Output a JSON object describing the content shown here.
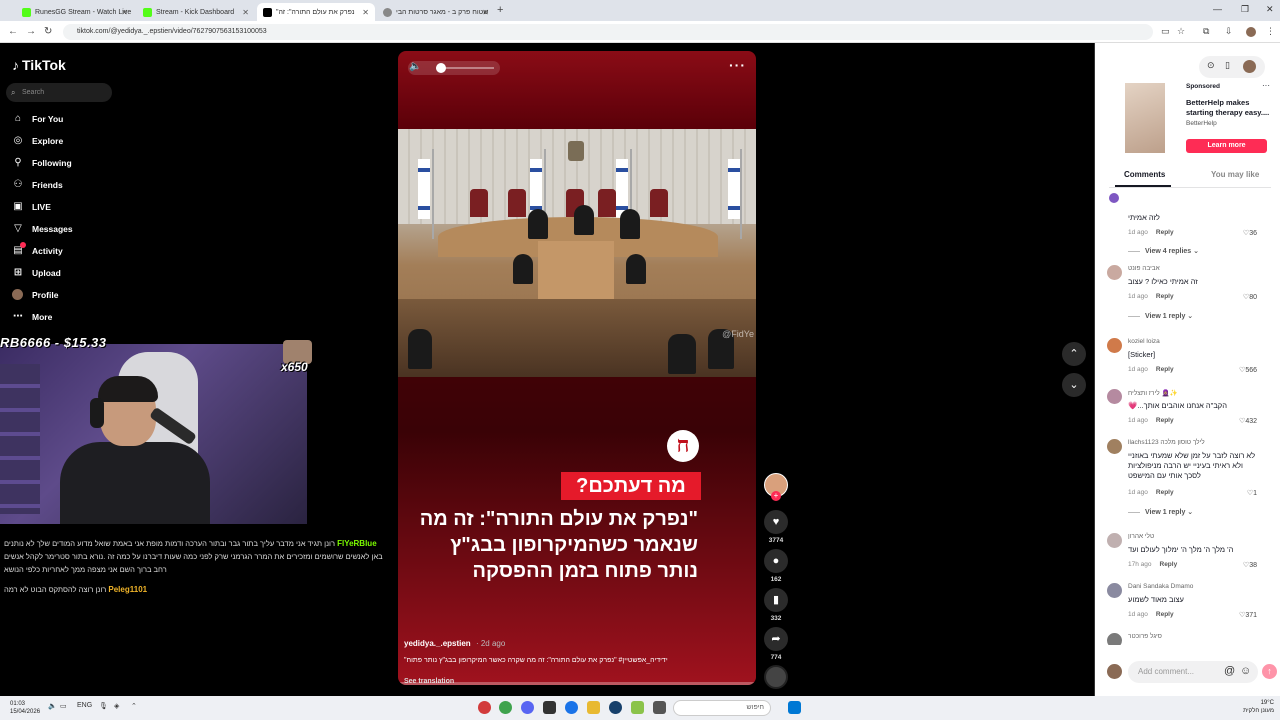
{
  "browser": {
    "tabs": [
      {
        "title": "RunesGG Stream - Watch Live",
        "color": "#53fc18"
      },
      {
        "title": "Stream - Kick Dashboard",
        "color": "#53fc18"
      },
      {
        "title": "\"נפרק את עולם התורה\": זה",
        "color": "#000000"
      },
      {
        "title": "שטוח פרק ב - מאגר סרטות הבי",
        "color": "#888888"
      }
    ],
    "url": "tiktok.com/@yedidya._.epstien/video/7627907563153100053"
  },
  "tiktok": {
    "logo": "TikTok",
    "search_placeholder": "Search",
    "nav": [
      {
        "label": "For You",
        "icon": "home-icon"
      },
      {
        "label": "Explore",
        "icon": "compass-icon"
      },
      {
        "label": "Following",
        "icon": "following-icon"
      },
      {
        "label": "Friends",
        "icon": "friends-icon"
      },
      {
        "label": "LIVE",
        "icon": "live-icon"
      },
      {
        "label": "Messages",
        "icon": "messages-icon"
      },
      {
        "label": "Activity",
        "icon": "activity-icon"
      },
      {
        "label": "Upload",
        "icon": "upload-icon"
      },
      {
        "label": "Profile",
        "icon": "avatar"
      },
      {
        "label": "More",
        "icon": "more-icon"
      }
    ]
  },
  "stream_overlay": {
    "donation": "RB6666 - $15.33",
    "multiplier": "x650",
    "chat": [
      {
        "user": "FlYeRBlue",
        "color": "#7cfc00",
        "text": "רונן תגיד אני מדבר עליך בתור גבר ובתור הערכה ודמות מופת אני באמת שואל מדוע המודים שלך לא נותנים באן לאנשים שרושמים ומזכירים את המרר הגרמני שרק לפני כמה שעות דיברנו על כמה זה .נורא בתור סטרימר לקהל אנשים רחב ברוך השם אני מצפה ממך לאחריות כלפי הנושא"
      },
      {
        "user": "Peleg1101",
        "color": "#f0b429",
        "text": "רונן רוצה להסתקס הבוט לא רמה"
      }
    ]
  },
  "video": {
    "badge_label": "מה דעתכם?",
    "headline": "\"נפרק את עולם התורה\": זה מה שנאמר כשהמיקרופון בבג\"ץ נותר פתוח בזמן ההפסקה",
    "channel_logo": "ח",
    "watermark": "@FidYe",
    "author": "yedidya._.epstien",
    "posted": "2d ago",
    "caption": "ידידיה_אפשטיין# \"נפרק את עולם התורה\": זה מה שקרה כאשר המיקרופון בבג\"ץ נותר פתוח\"",
    "see_translation": "See translation",
    "volume_level": 0.05
  },
  "actions": {
    "likes": "3774",
    "comments": "162",
    "saves": "332",
    "shares": "774"
  },
  "ad": {
    "sponsored": "Sponsored",
    "title": "BetterHelp makes starting therapy easy....",
    "brand": "BetterHelp",
    "cta": "Learn more"
  },
  "panel_tabs": {
    "comments": "Comments",
    "you_may_like": "You may like"
  },
  "comments": [
    {
      "name": "",
      "text": "לזה אמיתי",
      "time": "1d ago",
      "likes": "36",
      "replies": "View 4 replies",
      "color": "#7e57c2"
    },
    {
      "name": "אביבה פונט",
      "text": "זה אמיתי כאילו ? עצוב",
      "time": "1d ago",
      "likes": "80",
      "replies": "View 1 reply",
      "color": "#c9a9a0"
    },
    {
      "name": "koziel loiza",
      "text": "[Sticker]",
      "time": "1d ago",
      "likes": "566",
      "replies": "",
      "color": "#d07a4a"
    },
    {
      "name": "לירז ותצליח 🧕🏽✨",
      "text": "הקב\"ה אנחנו אוהבים אותך...💗",
      "time": "1d ago",
      "likes": "432",
      "replies": "",
      "color": "#b58aa0"
    },
    {
      "name": "llachs1123 לילך טוסון מלכה",
      "text": "לא רוצה לזבר על זמן שלא שמעתי באוזניי ולא ראיתי בעיניי יש הרבה מניפולציות לסכך אותי עם המישפט",
      "time": "1d ago",
      "likes": "1",
      "replies": "View 1 reply",
      "color": "#a08060"
    },
    {
      "name": "טלי אהרון",
      "text": "ה' מלך ה' מלך ה' ימלוך לעולם ועד",
      "time": "17h ago",
      "likes": "38",
      "replies": "",
      "color": "#c0b0b0"
    },
    {
      "name": "Dani Sandaka Dmamo",
      "text": "עצוב מאוד לשמוע",
      "time": "1d ago",
      "likes": "371",
      "replies": "",
      "color": "#8a8aa0"
    },
    {
      "name": "סיגל פרוכטר",
      "text": "",
      "time": "",
      "likes": "",
      "replies": "",
      "color": "#7a7a7a"
    }
  ],
  "composer": {
    "placeholder": "Add comment..."
  },
  "taskbar": {
    "time": "01:03",
    "date": "15/04/2026",
    "lang": "ENG",
    "search_text": "חיפוש",
    "weather_temp": "19°C",
    "weather_desc": "מעונן חלקית"
  }
}
